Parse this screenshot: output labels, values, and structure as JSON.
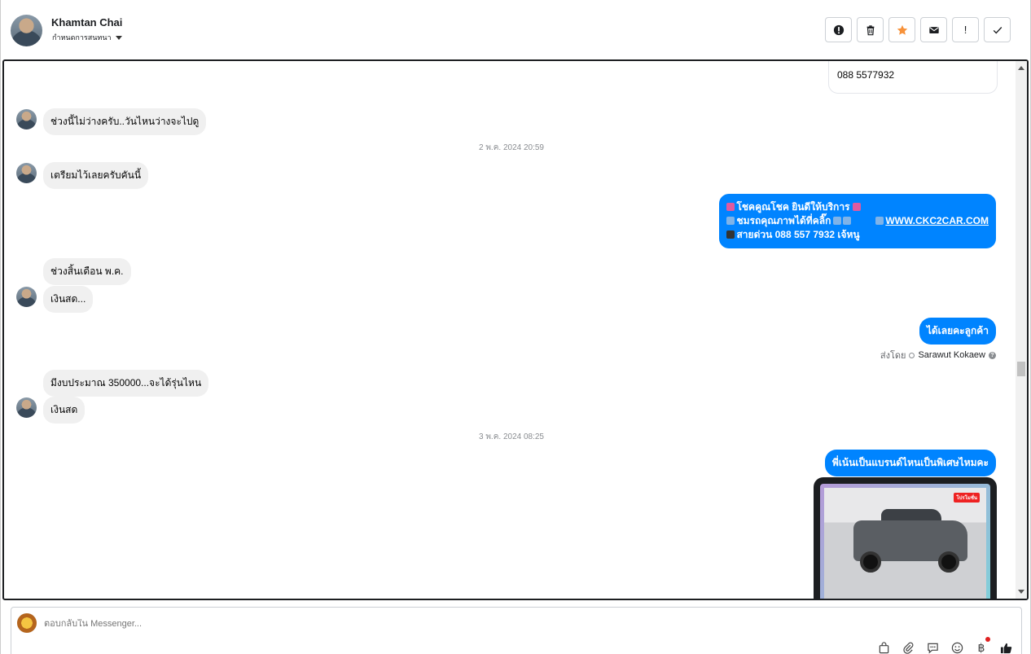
{
  "header": {
    "contact_name": "Khamtan Chai",
    "assign_label": "กำหนดการสนทนา",
    "actions": [
      {
        "icon": "alert-circle-icon"
      },
      {
        "icon": "trash-icon"
      },
      {
        "icon": "star-icon",
        "color": "#f7923a"
      },
      {
        "icon": "mail-icon"
      },
      {
        "icon": "exclamation-icon",
        "label": "!"
      },
      {
        "icon": "check-icon"
      }
    ]
  },
  "conversation": {
    "card_phone": "088 5577932",
    "messages": {
      "m1": "ช่วงนี้ไม่ว่างครับ..วันไหนว่างจะไปดู",
      "ts1": "2 พ.ค. 2024 20:59",
      "m2": "เตรียมไว้เลยครับคันนี้",
      "out1_line1": "โชคคูณโชค ยินดีให้บริการ",
      "out1_line2": "ชมรถคุณภาพได้ที่คลิ๊ก",
      "out1_link": "WWW.CKC2CAR.COM",
      "out1_line3": "สายด่วน 088 557 7932 เจ้หนู",
      "m3": "ช่วงสิ้นเดือน พ.ค.",
      "m4": "เงินสด...",
      "out2": "ได้เลยคะลูกค้า",
      "sent_by_label": "ส่งโดย",
      "sent_by_name": "Sarawut Kokaew",
      "m5": "มีงบประมาณ 350000...จะได้รุ่นไหน",
      "m6": "เงินสด",
      "ts2": "3 พ.ค. 2024 08:25",
      "out3": "พี่เน้นเป็นแบรนด์ไหนเป็นพิเศษไหมคะ"
    },
    "photo_badge": "โปรโมชั่น"
  },
  "composer": {
    "placeholder": "ตอบกลับใน Messenger...",
    "tools": [
      "bag-icon",
      "paperclip-icon",
      "chat-bubble-icon",
      "emoji-icon",
      "baht-icon",
      "thumbs-up-icon"
    ]
  },
  "colors": {
    "accent": "#0084ff",
    "incoming_bubble": "#f0f0f0",
    "star": "#f7923a"
  }
}
